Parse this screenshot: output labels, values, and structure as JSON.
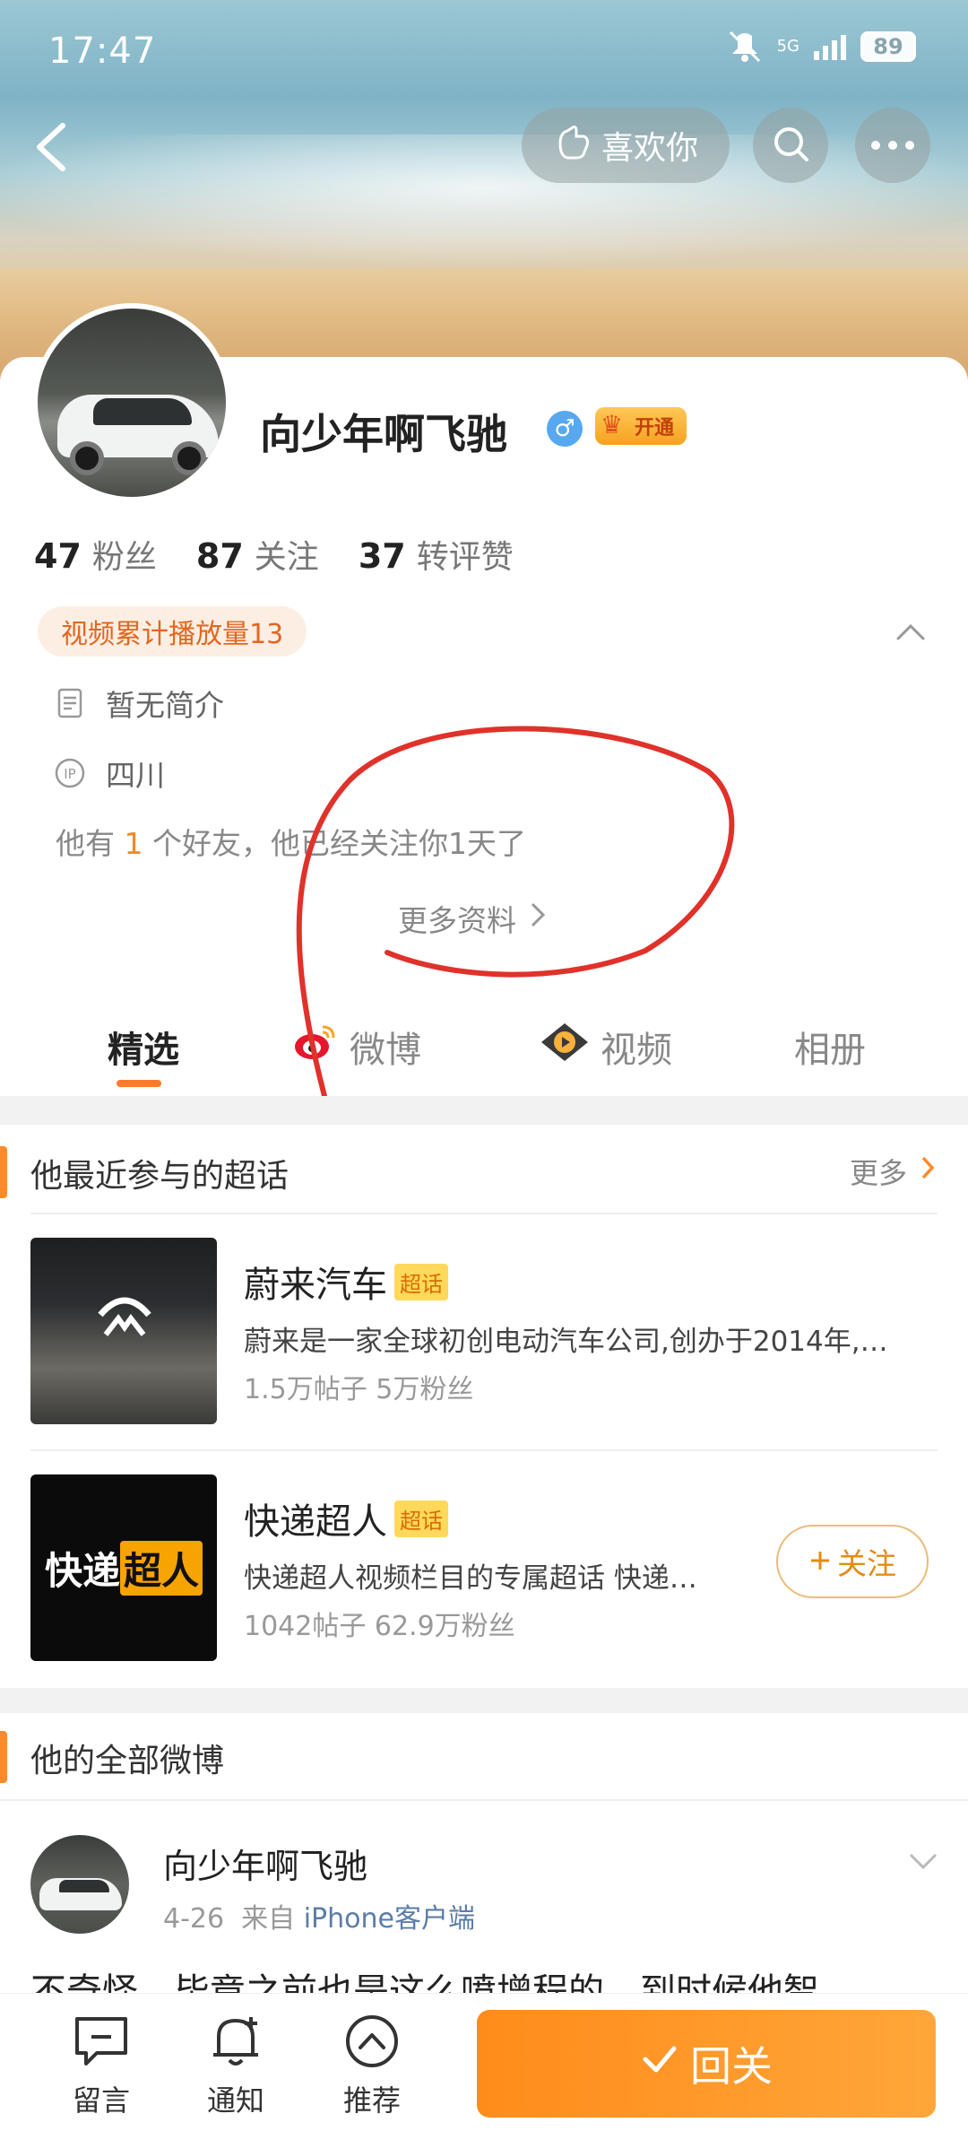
{
  "status_bar": {
    "time": "17:47",
    "network": "5G",
    "battery": "89"
  },
  "header": {
    "like_label": "喜欢你"
  },
  "profile": {
    "name": "向少年啊飞驰",
    "gender": "♂",
    "vip_label": "开通",
    "stats": [
      {
        "value": "47",
        "label": "粉丝"
      },
      {
        "value": "87",
        "label": "关注"
      },
      {
        "value": "37",
        "label": "转评赞"
      }
    ],
    "play_tag": "视频累计播放量13",
    "bio": "暂无简介",
    "ip_label": "IP",
    "location": "四川",
    "friends_prefix": "他有",
    "friends_count": "1",
    "friends_suffix": "个好友，他已经关注你1天了",
    "more_info": "更多资料"
  },
  "tabs": [
    {
      "label": "精选",
      "icon": "none"
    },
    {
      "label": "微博",
      "icon": "weibo-icon"
    },
    {
      "label": "视频",
      "icon": "video-icon"
    },
    {
      "label": "相册",
      "icon": "none"
    }
  ],
  "super_topics": {
    "title": "他最近参与的超话",
    "more": "更多",
    "badge": "超话",
    "items": [
      {
        "name": "蔚来汽车",
        "desc": "蔚来是一家全球初创电动汽车公司,创办于2014年,…",
        "meta": "1.5万帖子 5万粉丝"
      },
      {
        "name": "快递超人",
        "desc": "快递超人视频栏目的专属超话 快递…",
        "meta": "1042帖子 62.9万粉丝",
        "follow": "关注",
        "thumb_text_a": "快递",
        "thumb_text_b": "超人"
      }
    ]
  },
  "posts": {
    "title": "他的全部微博",
    "author": "向少年啊飞驰",
    "date": "4-26",
    "from_label": "来自",
    "source": "iPhone客户端",
    "text": "不奇怪，毕竟之前也是这么喷增程的，到时候他智"
  },
  "bottom_bar": {
    "items": [
      {
        "label": "留言",
        "icon": "comment-icon"
      },
      {
        "label": "通知",
        "icon": "bell-icon"
      },
      {
        "label": "推荐",
        "icon": "recommend-icon"
      }
    ],
    "followback": "回关"
  },
  "colors": {
    "accent": "#ff8a2a",
    "orange_text": "#e2671f",
    "annotation": "#e0322a"
  }
}
